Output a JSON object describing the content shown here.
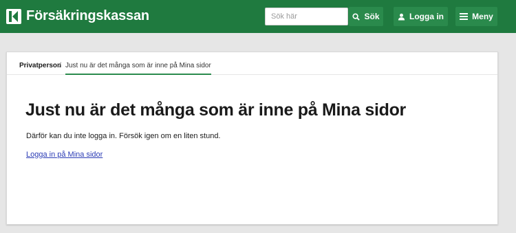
{
  "brand": {
    "name": "Försäkringskassan",
    "logo_icon": "k-logo-icon"
  },
  "header": {
    "search": {
      "placeholder": "Sök här",
      "button_label": "Sök"
    },
    "login_label": "Logga in",
    "menu_label": "Meny"
  },
  "breadcrumb": {
    "home": "Privatperson",
    "separator": "/",
    "current": "Just nu är det många som är inne på Mina sidor"
  },
  "main": {
    "title": "Just nu är det många som är inne på Mina sidor",
    "description": "Därför kan du inte logga in. Försök igen om en liten stund.",
    "link": "Logga in på Mina sidor"
  },
  "colors": {
    "brand_green": "#1f7a3f",
    "button_green": "#2a8a4c",
    "link_blue": "#2a3bb5"
  }
}
